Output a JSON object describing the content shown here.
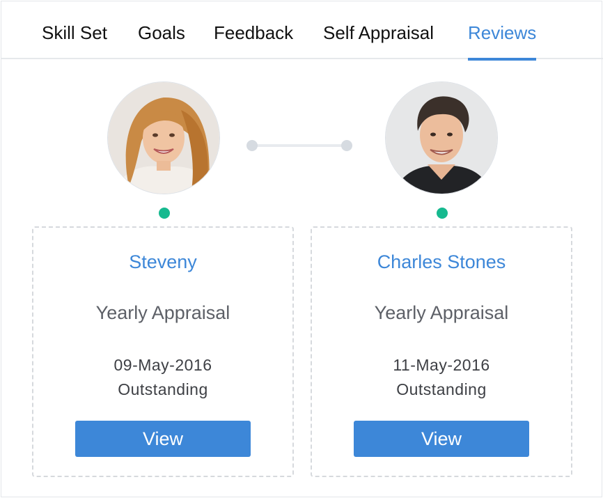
{
  "tabs": [
    {
      "label": "Skill Set",
      "active": false
    },
    {
      "label": "Goals",
      "active": false
    },
    {
      "label": "Feedback",
      "active": false
    },
    {
      "label": "Self Appraisal",
      "active": false
    },
    {
      "label": "Reviews",
      "active": true
    }
  ],
  "reviews": [
    {
      "name": "Steveny",
      "type": "Yearly Appraisal",
      "date": "09-May-2016",
      "rating": "Outstanding",
      "button_label": "View",
      "status_color": "#16b98f"
    },
    {
      "name": "Charles Stones",
      "type": "Yearly Appraisal",
      "date": "11-May-2016",
      "rating": "Outstanding",
      "button_label": "View",
      "status_color": "#16b98f"
    }
  ],
  "colors": {
    "accent": "#3d87d8",
    "status": "#16b98f",
    "card_border": "#d6d9dd"
  }
}
